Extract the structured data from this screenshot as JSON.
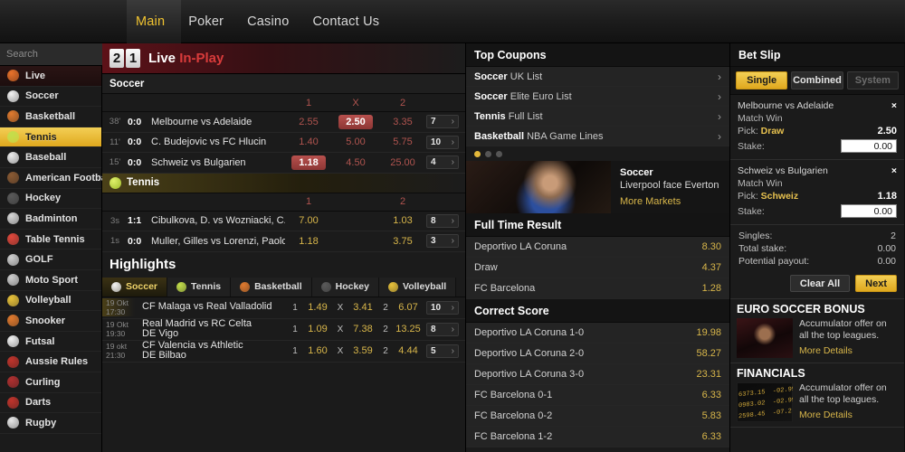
{
  "nav": {
    "items": [
      {
        "label": "Main",
        "active": true
      },
      {
        "label": "Poker",
        "active": false
      },
      {
        "label": "Casino",
        "active": false
      },
      {
        "label": "Contact Us",
        "active": false
      }
    ]
  },
  "search": {
    "placeholder": "Search",
    "value": "",
    "icon": "search-icon"
  },
  "sidebar": {
    "items": [
      {
        "label": "Live",
        "icon": "flame-icon",
        "color": "#e8722a",
        "state": "live"
      },
      {
        "label": "Soccer",
        "icon": "soccer-ball-icon",
        "color": "#f2f2f2",
        "state": ""
      },
      {
        "label": "Basketball",
        "icon": "basketball-icon",
        "color": "#e07a2e",
        "state": ""
      },
      {
        "label": "Tennis",
        "icon": "tennis-ball-icon",
        "color": "#c3de4a",
        "state": "active"
      },
      {
        "label": "Baseball",
        "icon": "baseball-icon",
        "color": "#ededed",
        "state": ""
      },
      {
        "label": "American Football",
        "icon": "football-icon",
        "color": "#8a5a33",
        "state": ""
      },
      {
        "label": "Hockey",
        "icon": "hockey-puck-icon",
        "color": "#5a5a5a",
        "state": ""
      },
      {
        "label": "Badminton",
        "icon": "shuttlecock-icon",
        "color": "#d8d8d8",
        "state": ""
      },
      {
        "label": "Table Tennis",
        "icon": "table-tennis-icon",
        "color": "#e0483c",
        "state": ""
      },
      {
        "label": "GOLF",
        "icon": "golf-club-icon",
        "color": "#d0d0d0",
        "state": ""
      },
      {
        "label": "Moto Sport",
        "icon": "checkered-flag-icon",
        "color": "#cfcfcf",
        "state": ""
      },
      {
        "label": "Volleyball",
        "icon": "volleyball-icon",
        "color": "#e8c23a",
        "state": ""
      },
      {
        "label": "Snooker",
        "icon": "snooker-balls-icon",
        "color": "#e07a2e",
        "state": ""
      },
      {
        "label": "Futsal",
        "icon": "futsal-ball-icon",
        "color": "#f2f2f2",
        "state": ""
      },
      {
        "label": "Aussie Rules",
        "icon": "aussie-ball-icon",
        "color": "#c0342c",
        "state": ""
      },
      {
        "label": "Curling",
        "icon": "curling-stone-icon",
        "color": "#b03030",
        "state": ""
      },
      {
        "label": "Darts",
        "icon": "dartboard-icon",
        "color": "#c0342c",
        "state": ""
      },
      {
        "label": "Rugby",
        "icon": "rugby-ball-icon",
        "color": "#e8e8e8",
        "state": ""
      }
    ]
  },
  "live": {
    "logo_left": "2",
    "logo_right": "1",
    "title": "Live",
    "title_accent": "In-Play",
    "soccer": {
      "header": "Soccer",
      "cols": [
        "1",
        "X",
        "2"
      ],
      "rows": [
        {
          "min": "38'",
          "score": "0:0",
          "teams": "Melbourne  vs Adelaide",
          "o1": "2.55",
          "ox": "2.50",
          "o2": "3.35",
          "highlight": "X",
          "markets": "7"
        },
        {
          "min": "11'",
          "score": "0:0",
          "teams": "C. Budejovic vs FC Hlucin",
          "o1": "1.40",
          "ox": "5.00",
          "o2": "5.75",
          "highlight": "",
          "markets": "10"
        },
        {
          "min": "15'",
          "score": "0:0",
          "teams": "Schweiz  vs Bulgarien",
          "o1": "1.18",
          "ox": "4.50",
          "o2": "25.00",
          "highlight": "1",
          "markets": "4"
        }
      ]
    },
    "tennis": {
      "header": "Tennis",
      "cols": [
        "1",
        "2"
      ],
      "rows": [
        {
          "min": "3s",
          "score": "1:1",
          "teams": "Cibulkova, D. vs Wozniacki, C.",
          "o1": "7.00",
          "o2": "1.03",
          "markets": "8"
        },
        {
          "min": "1s",
          "score": "0:0",
          "teams": "Muller, Gilles vs Lorenzi, Paolo",
          "o1": "1.18",
          "o2": "3.75",
          "markets": "3"
        }
      ]
    }
  },
  "highlights": {
    "title": "Highlights",
    "tabs": [
      {
        "label": "Soccer",
        "icon": "soccer-ball-icon",
        "color": "#f2f2f2",
        "active": true
      },
      {
        "label": "Tennis",
        "icon": "tennis-ball-icon",
        "color": "#c3de4a",
        "active": false
      },
      {
        "label": "Basketball",
        "icon": "basketball-icon",
        "color": "#e07a2e",
        "active": false
      },
      {
        "label": "Hockey",
        "icon": "hockey-puck-icon",
        "color": "#5a5a5a",
        "active": false
      },
      {
        "label": "Volleyball",
        "icon": "volleyball-icon",
        "color": "#e8c23a",
        "active": false
      }
    ],
    "rows": [
      {
        "date": "19 Okt",
        "time": "17:30",
        "name": "CF Malaga vs Real Valladolid",
        "name2": "",
        "l1": "1",
        "v1": "1.49",
        "lx": "X",
        "vx": "3.41",
        "l2": "2",
        "v2": "6.07",
        "markets": "10"
      },
      {
        "date": "19 Okt",
        "time": "19:30",
        "name": "Real Madrid vs RC Celta",
        "name2": "DE Vigo",
        "l1": "1",
        "v1": "1.09",
        "lx": "X",
        "vx": "7.38",
        "l2": "2",
        "v2": "13.25",
        "markets": "8"
      },
      {
        "date": "19 okt",
        "time": "21:30",
        "name": "CF Valencia vs Athletic",
        "name2": "DE Bilbao",
        "l1": "1",
        "v1": "1.60",
        "lx": "X",
        "vx": "3.59",
        "l2": "2",
        "v2": "4.44",
        "markets": "5"
      }
    ]
  },
  "coupons": {
    "title": "Top Coupons",
    "items": [
      {
        "bold": "Soccer",
        "rest": " UK List"
      },
      {
        "bold": "Soccer",
        "rest": " Elite Euro List"
      },
      {
        "bold": "Tennis",
        "rest": " Full List"
      },
      {
        "bold": "Basketball",
        "rest": " NBA Game Lines"
      }
    ]
  },
  "feature": {
    "dots": [
      true,
      false,
      false
    ],
    "sport": "Soccer",
    "caption": "Liverpool face Everton",
    "more": "More Markets"
  },
  "full_time_result": {
    "title": "Full Time Result",
    "rows": [
      {
        "label": "Deportivo LA Coruna",
        "value": "8.30"
      },
      {
        "label": "Draw",
        "value": "4.37"
      },
      {
        "label": "FC Barcelona",
        "value": "1.28"
      }
    ]
  },
  "correct_score": {
    "title": "Correct Score",
    "rows": [
      {
        "label": "Deportivo LA Coruna 1-0",
        "value": "19.98"
      },
      {
        "label": "Deportivo LA Coruna 2-0",
        "value": "58.27"
      },
      {
        "label": "Deportivo LA Coruna 3-0",
        "value": "23.31"
      },
      {
        "label": "FC Barcelona 0-1",
        "value": "6.33"
      },
      {
        "label": "FC Barcelona 0-2",
        "value": "5.83"
      },
      {
        "label": "FC Barcelona 1-2",
        "value": "6.33"
      }
    ]
  },
  "betslip": {
    "title": "Bet Slip",
    "tabs": [
      {
        "label": "Single",
        "state": "active"
      },
      {
        "label": "Combined",
        "state": ""
      },
      {
        "label": "System",
        "state": "off"
      }
    ],
    "bets": [
      {
        "match": "Melbourne  vs Adelaide",
        "market": "Match Win",
        "pick_label": "Pick:",
        "pick": "Draw",
        "odds": "2.50",
        "stake_label": "Stake:",
        "stake": "0.00",
        "remove": "×"
      },
      {
        "match": "Schweiz  vs Bulgarien",
        "market": "Match Win",
        "pick_label": "Pick:",
        "pick": "Schweiz",
        "odds": "1.18",
        "stake_label": "Stake:",
        "stake": "0.00",
        "remove": "×"
      }
    ],
    "totals": [
      {
        "label": "Singles:",
        "value": "2"
      },
      {
        "label": "Total stake:",
        "value": "0.00"
      },
      {
        "label": "Potential payout:",
        "value": "0.00"
      }
    ],
    "clear_label": "Clear All",
    "next_label": "Next"
  },
  "promos": [
    {
      "title": "EURO SOCCER BONUS",
      "text": "Accumulator offer on all the top leagues.",
      "more": "More Details",
      "image": "player-photo"
    },
    {
      "title": "FINANCIALS",
      "text": "Accumulator offer on all the top leagues.",
      "more": "More Details",
      "image": "stock-ticker"
    }
  ],
  "colors": {
    "accent": "#dfa81e",
    "live_red": "#d93b3b",
    "odds_gold": "#d8b64a",
    "odds_red": "#b0544f"
  }
}
